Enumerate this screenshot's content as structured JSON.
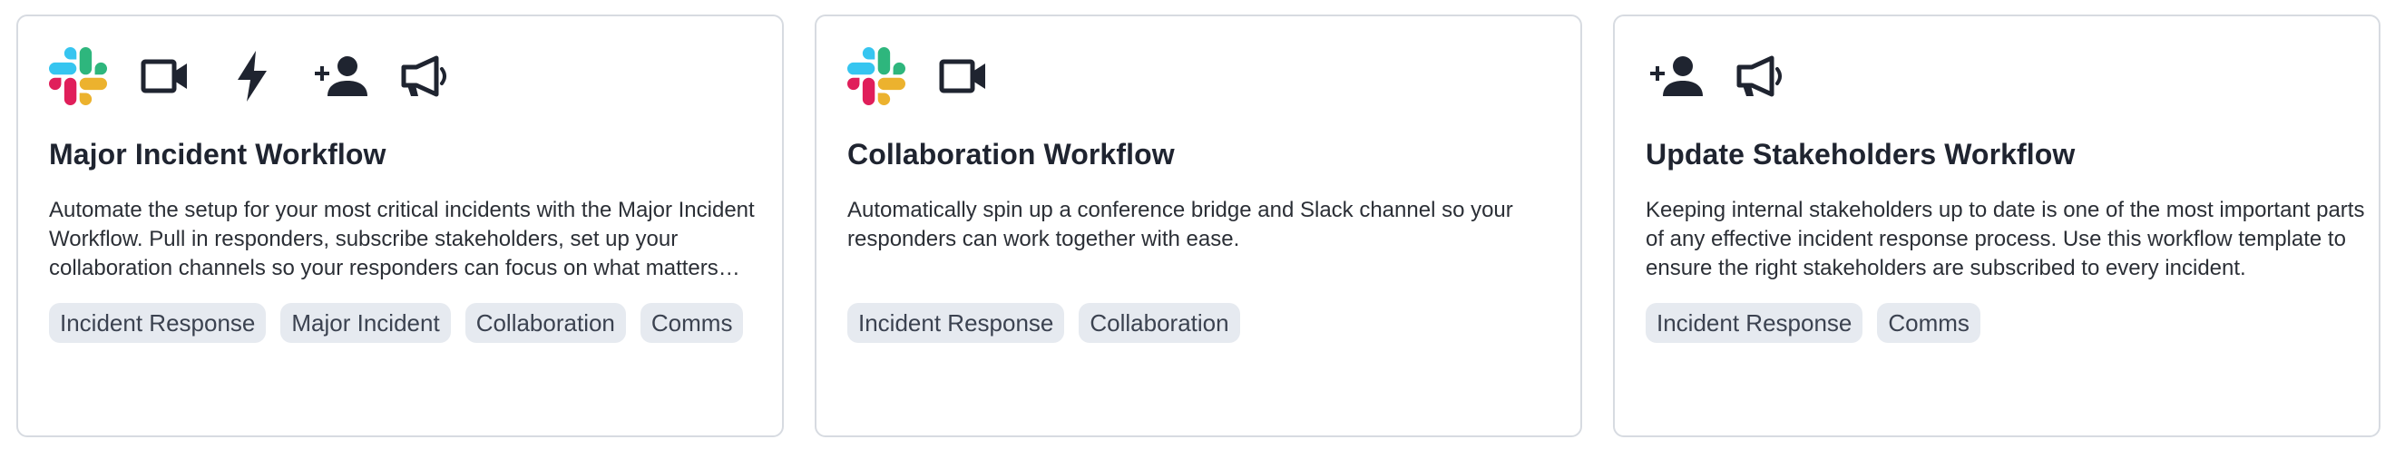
{
  "cards": [
    {
      "title": "Major Incident Workflow",
      "description": "Automate the setup for your most critical incidents with the Major Incident Workflow. Pull in responders, subscribe stakeholders, set up your collaboration channels so your responders can focus on what matters most: resolving the incident.",
      "icons": [
        "slack-icon",
        "video-camera-icon",
        "lightning-bolt-icon",
        "add-person-icon",
        "megaphone-icon"
      ],
      "tags": [
        "Incident Response",
        "Major Incident",
        "Collaboration",
        "Comms"
      ]
    },
    {
      "title": "Collaboration Workflow",
      "description": "Automatically spin up a conference bridge and Slack channel so your responders can work together with ease.",
      "icons": [
        "slack-icon",
        "video-camera-icon"
      ],
      "tags": [
        "Incident Response",
        "Collaboration"
      ]
    },
    {
      "title": "Update Stakeholders Workflow",
      "description": "Keeping internal stakeholders up to date is one of the most important parts of any effective incident response process. Use this workflow template to ensure the right stakeholders are subscribed to every incident.",
      "icons": [
        "add-person-icon",
        "megaphone-icon"
      ],
      "tags": [
        "Incident Response",
        "Comms"
      ]
    }
  ],
  "colors": {
    "icon": "#1f2430",
    "tag_bg": "#e6eaf0",
    "tag_text": "#3b4250",
    "card_border": "#d7dbe1",
    "slack_blue": "#36C5F0",
    "slack_green": "#2EB67D",
    "slack_red": "#E01E5A",
    "slack_yellow": "#ECB22E"
  }
}
